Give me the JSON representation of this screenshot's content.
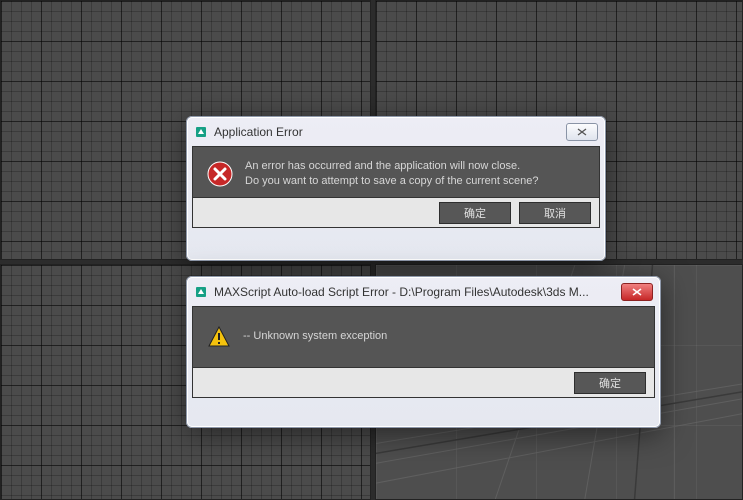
{
  "dialogs": {
    "app_error": {
      "title": "Application Error",
      "message": "An error has occurred and the application will now close.\nDo you want to attempt to save a copy of the current scene?",
      "ok_label": "确定",
      "cancel_label": "取消"
    },
    "script_error": {
      "title": "MAXScript Auto-load Script Error - D:\\Program Files\\Autodesk\\3ds M...",
      "message": "-- Unknown system exception",
      "ok_label": "确定"
    }
  }
}
